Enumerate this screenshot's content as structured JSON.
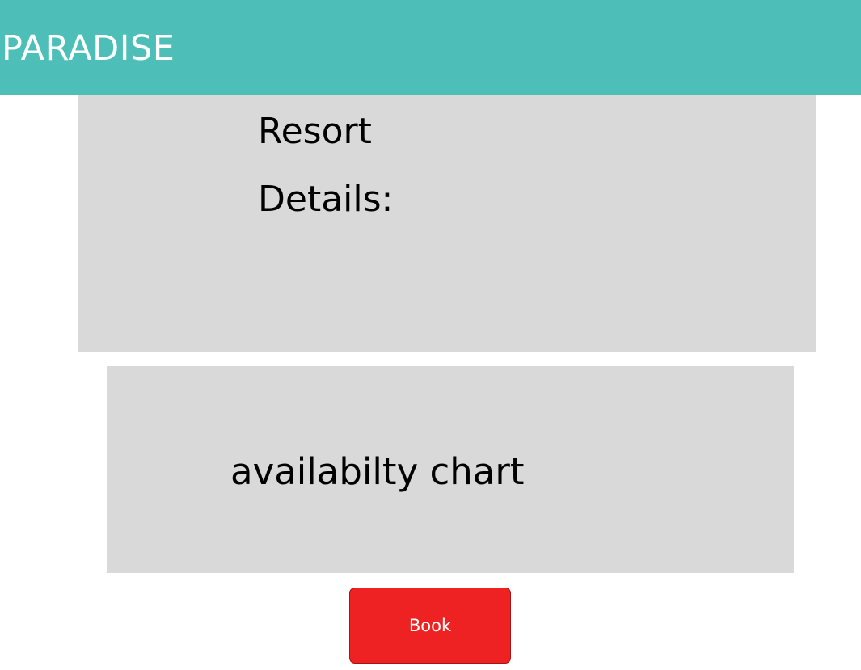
{
  "header": {
    "brand": "PARADISE",
    "background_color": "#4ebfb8"
  },
  "details": {
    "line1": "Resort",
    "line2": "Details:",
    "background_color": "#d9d9d9"
  },
  "availability": {
    "label": "availabilty chart",
    "background_color": "#d9d9d9"
  },
  "actions": {
    "book_label": "Book",
    "book_color": "#ee2222"
  }
}
